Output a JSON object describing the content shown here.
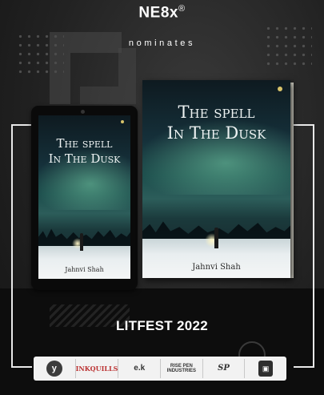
{
  "header": {
    "brand": "NE8x",
    "brand_mark": "®",
    "tagline": "nominates"
  },
  "book": {
    "title_line1": "The spell",
    "title_line2": "In The Dusk",
    "author": "Jahnvi Shah"
  },
  "event": {
    "name": "LITFEST 2022"
  },
  "sponsors": {
    "items": [
      {
        "icon": "y-circle-logo",
        "text": "y"
      },
      {
        "icon": "inkquills-logo",
        "text": "INKQUILLS"
      },
      {
        "icon": "ek-logo",
        "text": "e.k"
      },
      {
        "icon": "rise-pen-logo",
        "text": "RISE PEN INDUSTRIES"
      },
      {
        "icon": "script-logo",
        "text": "SP"
      },
      {
        "icon": "box-logo",
        "text": "▣"
      }
    ]
  },
  "colors": {
    "background": "#1a1a1a",
    "accent": "#ffffff",
    "sky": "#1c4d4c",
    "snow": "#e9eef0"
  }
}
